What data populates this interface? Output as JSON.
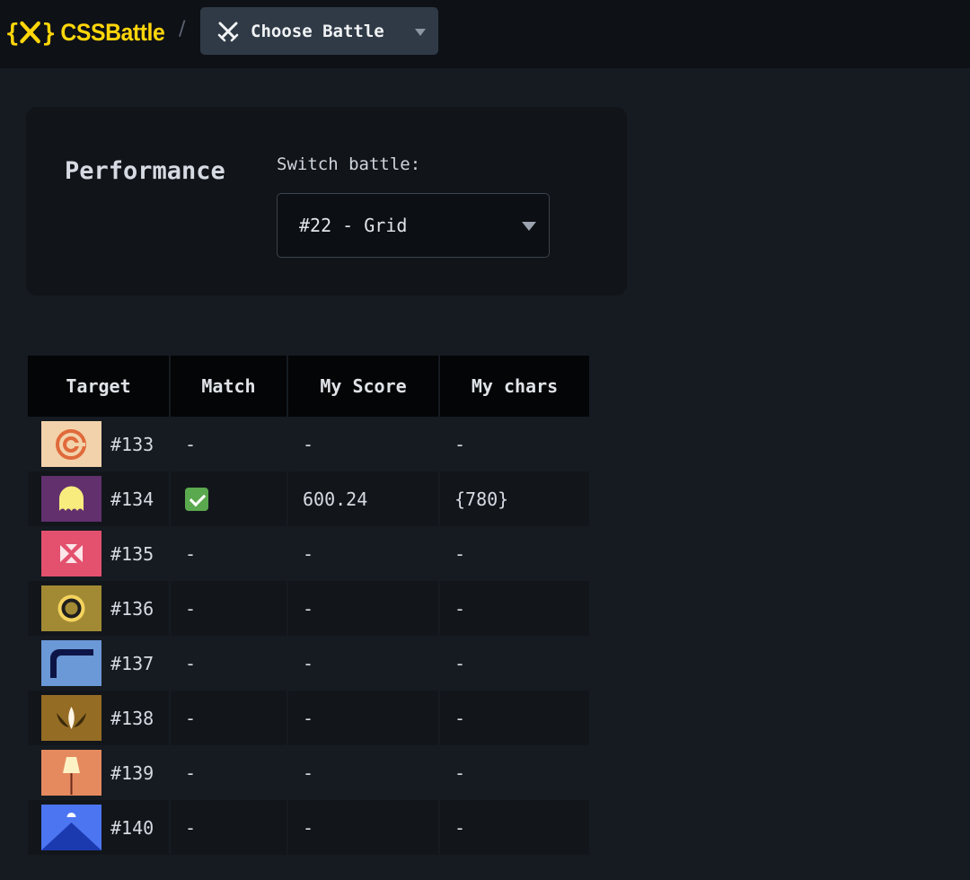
{
  "header": {
    "logo_text": "CSSBattle",
    "separator": "/",
    "choose_battle_label": "Choose Battle",
    "accent": "#ffd60a"
  },
  "performance": {
    "title": "Performance",
    "switch_label": "Switch battle:",
    "selected_battle": "#22 - Grid"
  },
  "table": {
    "headers": [
      "Target",
      "Match",
      "My Score",
      "My chars"
    ],
    "rows": [
      {
        "target": "#133",
        "match": "-",
        "score": "-",
        "chars": "-"
      },
      {
        "target": "#134",
        "match": "",
        "match_icon": "check-mark-icon",
        "score": "600.24",
        "chars": "{780}"
      },
      {
        "target": "#135",
        "match": "-",
        "score": "-",
        "chars": "-"
      },
      {
        "target": "#136",
        "match": "-",
        "score": "-",
        "chars": "-"
      },
      {
        "target": "#137",
        "match": "-",
        "score": "-",
        "chars": "-"
      },
      {
        "target": "#138",
        "match": "-",
        "score": "-",
        "chars": "-"
      },
      {
        "target": "#139",
        "match": "-",
        "score": "-",
        "chars": "-"
      },
      {
        "target": "#140",
        "match": "-",
        "score": "-",
        "chars": "-"
      }
    ]
  }
}
